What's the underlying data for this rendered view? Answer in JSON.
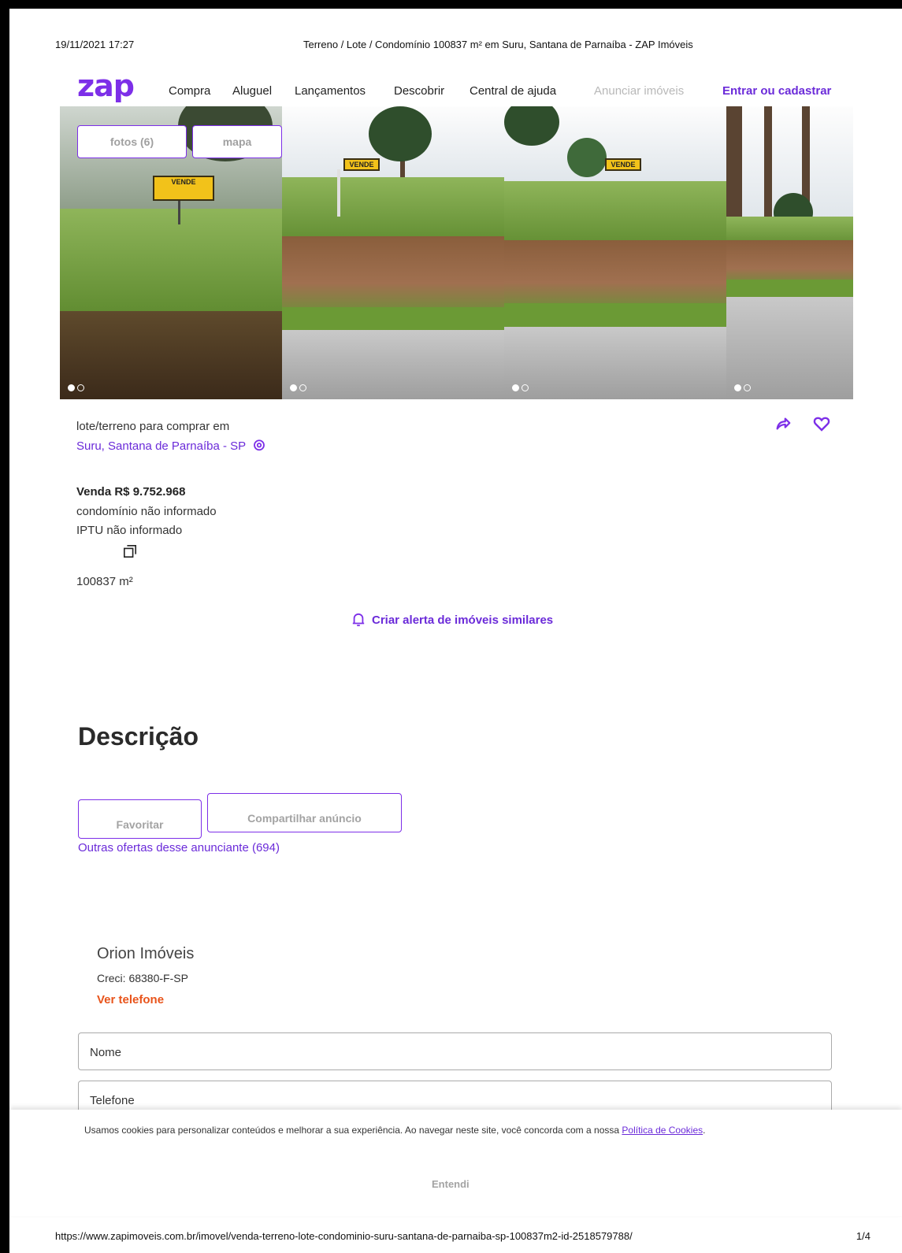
{
  "print_header": {
    "date": "19/11/2021 17:27",
    "title": "Terreno / Lote / Condomínio 100837 m² em Suru, Santana de Parnaíba - ZAP Imóveis"
  },
  "nav": {
    "logo": "zap",
    "items": [
      "Compra",
      "Aluguel",
      "Lançamentos",
      "Descobrir",
      "Central de ajuda"
    ],
    "announce": "Anunciar imóveis",
    "login": "Entrar ou cadastrar"
  },
  "gallery": {
    "photos_button": "fotos (6)",
    "map_button": "mapa",
    "sign_text": "VENDE",
    "icons": [
      "photo-1",
      "photo-2",
      "photo-3",
      "photo-4"
    ]
  },
  "listing": {
    "type_label": "lote/terreno para comprar em",
    "location": "Suru, Santana de Parnaíba - SP",
    "price": "Venda R$ 9.752.968",
    "condo": "condomínio não informado",
    "iptu": "IPTU não informado",
    "area": "100837 m²",
    "alert_link": "Criar alerta de imóveis similares"
  },
  "description": {
    "title": "Descrição",
    "favorite_button": "Favoritar",
    "share_button": "Compartilhar anúncio",
    "other_offers": "Outras ofertas desse anunciante (694)"
  },
  "advertiser": {
    "name": "Orion Imóveis",
    "creci": "Creci: 68380-F-SP",
    "phone_link": "Ver telefone"
  },
  "form": {
    "name_field": "Nome",
    "phone_field": "Telefone"
  },
  "cookie": {
    "text": "Usamos cookies para personalizar conteúdos e melhorar a sua experiência. Ao navegar neste site, você concorda com a nossa ",
    "link": "Política de Cookies",
    "period": ".",
    "button": "Entendi"
  },
  "print_footer": {
    "url": "https://www.zapimoveis.com.br/imovel/venda-terreno-lote-condominio-suru-santana-de-parnaiba-sp-100837m2-id-2518579788/",
    "page": "1/4"
  },
  "colors": {
    "brand": "#7d2fe8",
    "link": "#6b2bd9",
    "accent": "#e8541b"
  }
}
